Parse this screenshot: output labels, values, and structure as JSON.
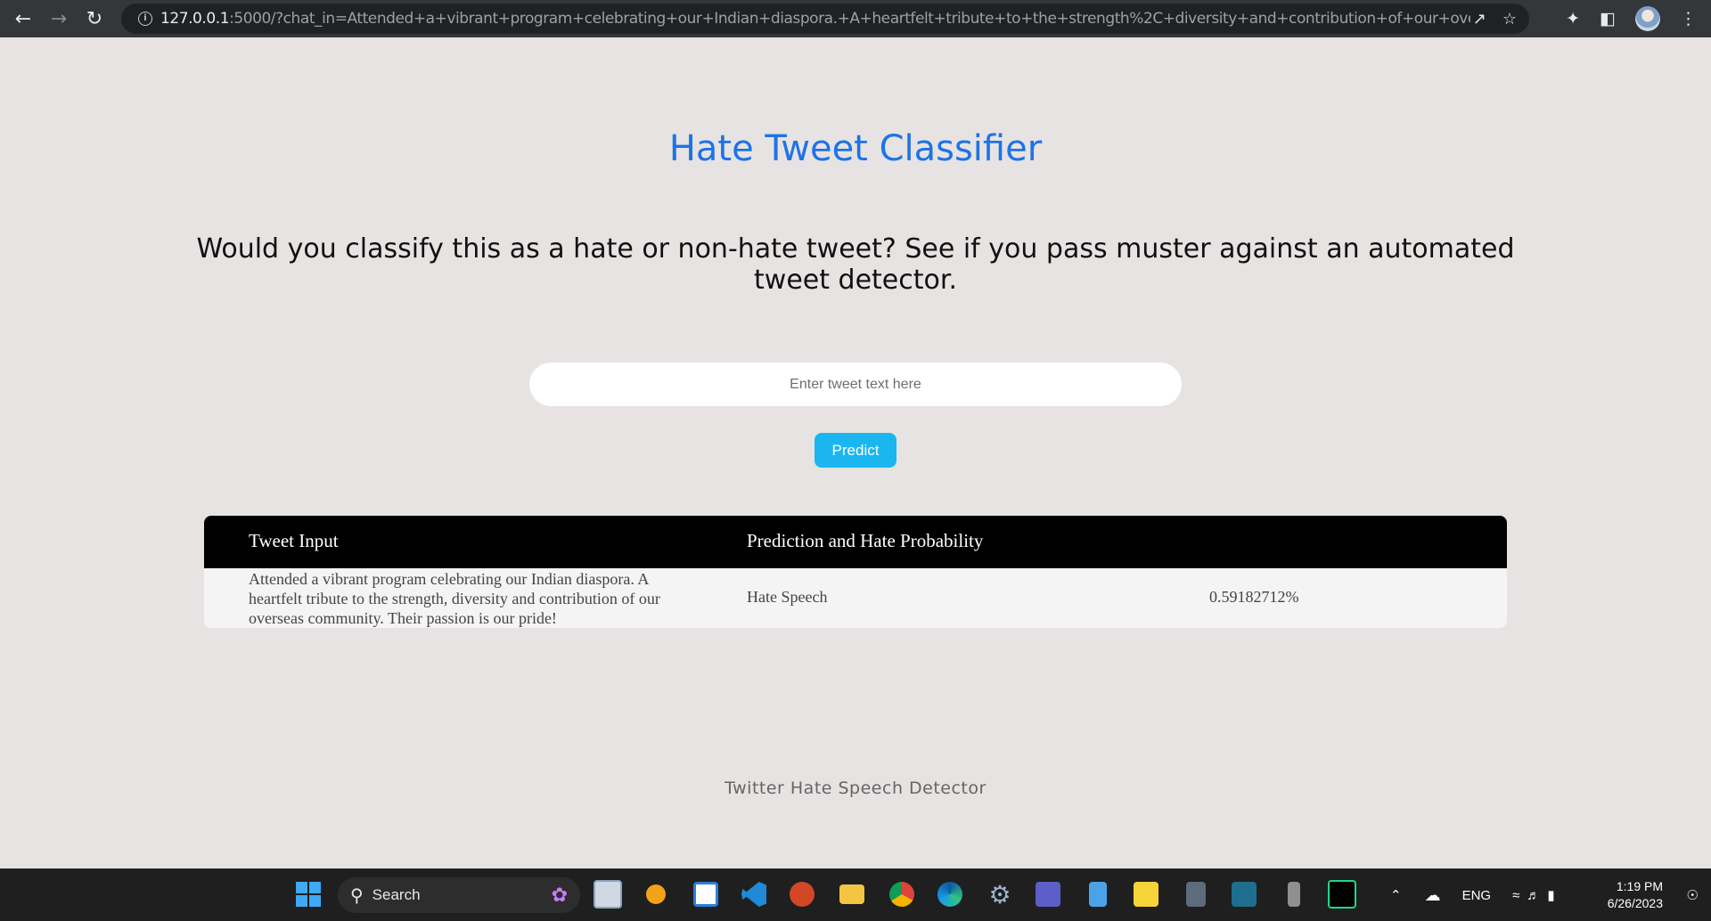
{
  "browser": {
    "url_host": "127.0.0.1",
    "url_rest": ":5000/?chat_in=Attended+a+vibrant+program+celebrating+our+Indian+diaspora.+A+heartfelt+tribute+to+the+strength%2C+diversity+and+contribution+of+our+overseas+com..."
  },
  "page": {
    "title": "Hate Tweet Classifier",
    "question": "Would you classify this as a hate or non-hate tweet? See if you pass muster against an automated tweet detector.",
    "input_placeholder": "Enter tweet text here",
    "predict_label": "Predict",
    "footer": "Twitter Hate Speech Detector"
  },
  "results": {
    "headers": [
      "Tweet Input",
      "Prediction and Hate Probability"
    ],
    "rows": [
      {
        "tweet": "Attended a vibrant program celebrating our Indian diaspora. A heartfelt tribute to the strength, diversity and contribution of our overseas community. Their passion is our pride!",
        "prediction": "Hate Speech",
        "probability": "0.59182712%"
      }
    ]
  },
  "taskbar": {
    "search_label": "Search",
    "language": "ENG",
    "time": "1:19 PM",
    "date": "6/26/2023"
  },
  "colors": {
    "title": "#1e73e8",
    "predict_button": "#1bb6ef",
    "page_background": "#e6e3e2",
    "table_header": "#000000"
  }
}
